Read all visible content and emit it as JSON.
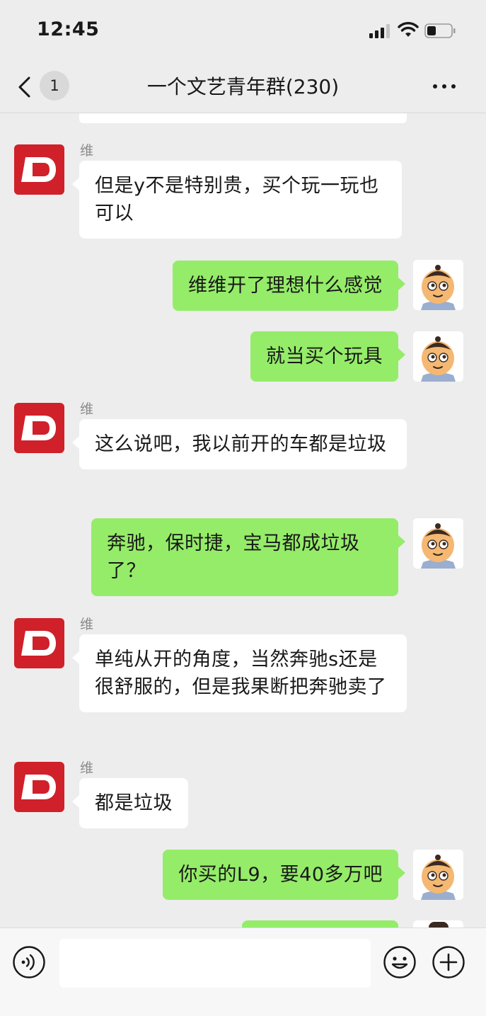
{
  "status_bar": {
    "time": "12:45"
  },
  "nav": {
    "unread_count": "1",
    "title": "一个文艺青年群(230)"
  },
  "messages": [
    {
      "side": "left",
      "sender": "维",
      "text": "但是y不是特别贵，买个玩一玩也可以"
    },
    {
      "side": "right",
      "text": "维维开了理想什么感觉"
    },
    {
      "side": "right",
      "text": "就当买个玩具"
    },
    {
      "side": "left",
      "sender": "维",
      "text": "这么说吧，我以前开的车都是垃圾"
    },
    {
      "side": "right",
      "text": "奔驰，保时捷，宝马都成垃圾了？"
    },
    {
      "side": "left",
      "sender": "维",
      "text": "单纯从开的角度，当然奔驰s还是很舒服的，但是我果断把奔驰卖了"
    },
    {
      "side": "left",
      "sender": "维",
      "text": "都是垃圾"
    },
    {
      "side": "right",
      "text": "你买的L9，要40多万吧"
    }
  ],
  "input_bar": {
    "placeholder": ""
  },
  "colors": {
    "background": "#ededed",
    "outgoing_bubble": "#95ec69",
    "incoming_bubble": "#ffffff",
    "avatar_brand_red": "#d0202a"
  },
  "icons": {
    "back": "chevron-left-icon",
    "more": "more-dots-icon",
    "voice": "voice-icon",
    "emoji": "emoji-icon",
    "add": "plus-circle-icon"
  }
}
